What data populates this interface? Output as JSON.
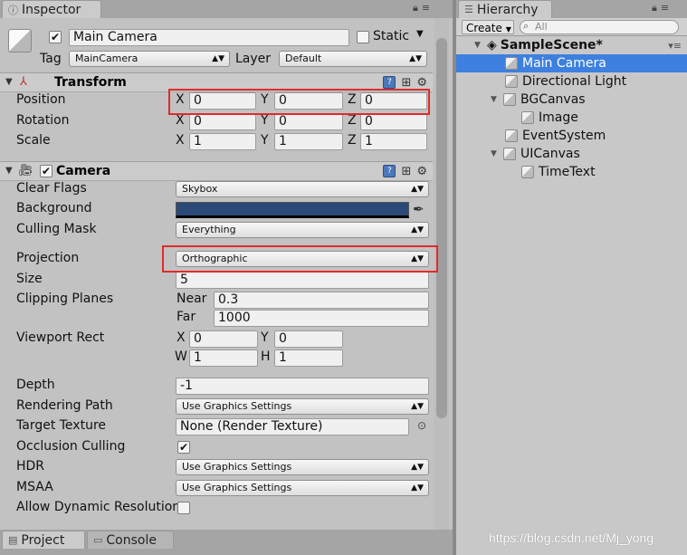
{
  "inspector": {
    "tab_title": "Inspector",
    "object": {
      "name": "Main Camera",
      "static_label": "Static",
      "tag_label": "Tag",
      "tag_value": "MainCamera",
      "layer_label": "Layer",
      "layer_value": "Default"
    },
    "transform": {
      "title": "Transform",
      "position_label": "Position",
      "rotation_label": "Rotation",
      "scale_label": "Scale",
      "position": {
        "x": "0",
        "y": "0",
        "z": "0"
      },
      "rotation": {
        "x": "0",
        "y": "0",
        "z": "0"
      },
      "scale": {
        "x": "1",
        "y": "1",
        "z": "1"
      },
      "axis_x": "X",
      "axis_y": "Y",
      "axis_z": "Z"
    },
    "camera": {
      "title": "Camera",
      "clear_flags_label": "Clear Flags",
      "clear_flags_value": "Skybox",
      "background_label": "Background",
      "background_color": "#2b4a78",
      "culling_mask_label": "Culling Mask",
      "culling_mask_value": "Everything",
      "projection_label": "Projection",
      "projection_value": "Orthographic",
      "size_label": "Size",
      "size_value": "5",
      "clipping_label": "Clipping Planes",
      "near_label": "Near",
      "near_value": "0.3",
      "far_label": "Far",
      "far_value": "1000",
      "viewport_label": "Viewport Rect",
      "vp_x_label": "X",
      "vp_x": "0",
      "vp_y_label": "Y",
      "vp_y": "0",
      "vp_w_label": "W",
      "vp_w": "1",
      "vp_h_label": "H",
      "vp_h": "1",
      "depth_label": "Depth",
      "depth_value": "-1",
      "rendering_path_label": "Rendering Path",
      "rendering_path_value": "Use Graphics Settings",
      "target_texture_label": "Target Texture",
      "target_texture_value": "None (Render Texture)",
      "occlusion_label": "Occlusion Culling",
      "hdr_label": "HDR",
      "hdr_value": "Use Graphics Settings",
      "msaa_label": "MSAA",
      "msaa_value": "Use Graphics Settings",
      "dynres_label": "Allow Dynamic Resolution"
    },
    "bottom_tabs": [
      "Project",
      "Console"
    ]
  },
  "hierarchy": {
    "tab_title": "Hierarchy",
    "create_label": "Create",
    "search_placeholder": "All",
    "scene_name": "SampleScene*",
    "items": [
      "Main Camera",
      "Directional Light",
      "BGCanvas",
      "Image",
      "EventSystem",
      "UICanvas",
      "TimeText"
    ]
  },
  "watermark": "https://blog.csdn.net/Mj_yong"
}
